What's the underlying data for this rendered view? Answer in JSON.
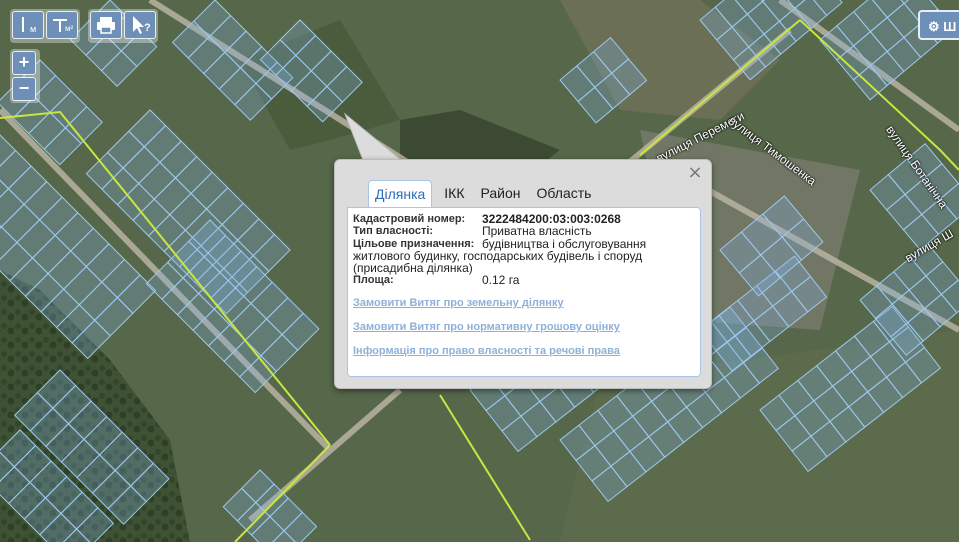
{
  "toolbar": {
    "measure_length_label": "м",
    "measure_area_label": "м²",
    "print_icon": "printer-icon",
    "identify_icon": "cursor-question-icon",
    "identify_label": "?"
  },
  "zoom": {
    "in_label": "+",
    "out_label": "−"
  },
  "layers_button": {
    "icon": "gear-icon",
    "label": "Ш"
  },
  "streets": [
    {
      "name": "вулиця Перемоги"
    },
    {
      "name": "вулиця Тимошенка"
    },
    {
      "name": "вулиця Ботанічна"
    },
    {
      "name": "вулиця Ш"
    }
  ],
  "popup": {
    "close_label": "×",
    "tabs": [
      {
        "label": "Ділянка",
        "active": true
      },
      {
        "label": "ІКК",
        "active": false
      },
      {
        "label": "Район",
        "active": false
      },
      {
        "label": "Область",
        "active": false
      }
    ],
    "fields": {
      "cadastral_label": "Кадастровий номер:",
      "cadastral_value": "3222484200:03:003:0268",
      "ownership_label": "Тип власності:",
      "ownership_value": "Приватна власність",
      "purpose_label": "Цільове призначення:",
      "purpose_value_line1": "будівництва і обслуговування",
      "purpose_value_line2": "житлового будинку, господарських будівель і споруд",
      "purpose_value_line3": "(присадибна ділянка)",
      "area_label": "Площа:",
      "area_value": "0.12 га"
    },
    "links": [
      "Замовити Витяг про земельну ділянку",
      "Замовити Витяг про нормативну грошову оцінку",
      "Інформація про право власності та речові права"
    ]
  },
  "colors": {
    "parcel_stroke": "#9ec8ee",
    "parcel_fill": "rgba(130,180,230,0.28)",
    "boundary_line": "#c8e640",
    "button": "#6d8fb8",
    "link": "#8fb1d8",
    "active_tab": "#2a6db8"
  }
}
